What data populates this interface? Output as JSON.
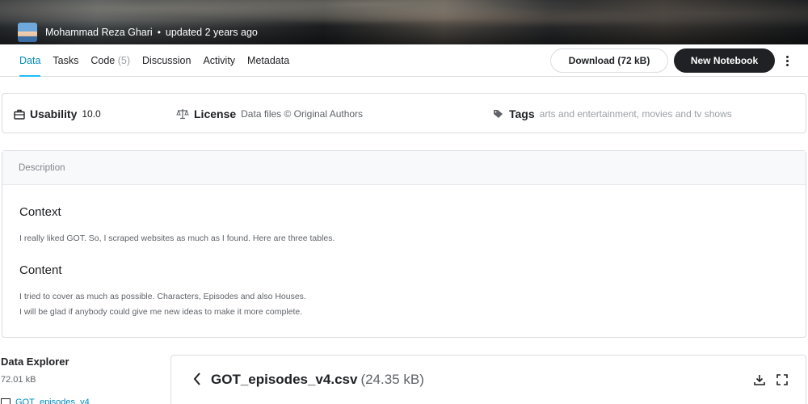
{
  "hero": {
    "author": "Mohammad Reza Ghari",
    "separator": "•",
    "updated": "updated 2 years ago"
  },
  "tabs": [
    {
      "label": "Data",
      "active": true
    },
    {
      "label": "Tasks"
    },
    {
      "label": "Code",
      "count": "(5)"
    },
    {
      "label": "Discussion"
    },
    {
      "label": "Activity"
    },
    {
      "label": "Metadata"
    }
  ],
  "actions": {
    "download_label": "Download (72 kB)",
    "notebook_label": "New Notebook",
    "more_icon": "more-vertical-icon"
  },
  "meta": {
    "usability_label": "Usability",
    "usability_value": "10.0",
    "license_label": "License",
    "license_value": "Data files © Original Authors",
    "tags_label": "Tags",
    "tags_value": "arts and entertainment, movies and tv shows"
  },
  "description": {
    "header": "Description",
    "context_heading": "Context",
    "context_text": "I really liked GOT. So, I scraped websites as much as I found. Here are three tables.",
    "content_heading": "Content",
    "content_line1": "I tried to cover as much as possible. Characters, Episodes and also Houses.",
    "content_line2": "I will be glad if anybody could give me new ideas to make it more complete."
  },
  "explorer": {
    "title": "Data Explorer",
    "size": "72.01 kB",
    "file_item": "GOT_episodes_v4",
    "panel_file": "GOT_episodes_v4.csv",
    "panel_size": "(24.35 kB)"
  },
  "colors": {
    "accent": "#20beff",
    "dark": "#202124",
    "border": "#dadce0"
  }
}
